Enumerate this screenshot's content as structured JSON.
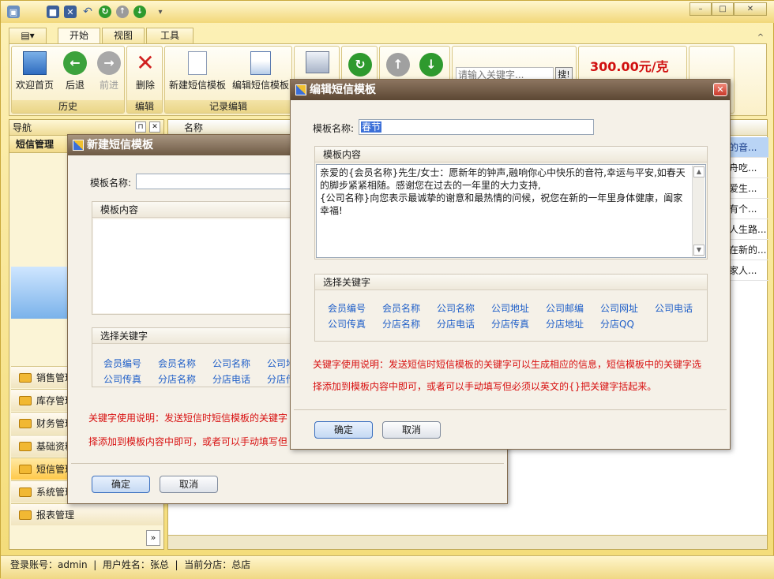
{
  "qat": {
    "icons": [
      "app-icon",
      "save-icon",
      "save-close-icon",
      "undo-icon",
      "refresh-icon",
      "up-icon",
      "down-icon",
      "customize-icon"
    ]
  },
  "tabs": [
    "开始",
    "视图",
    "工具"
  ],
  "ribbon": {
    "history": {
      "label": "历史",
      "home": "欢迎首页",
      "back": "后退",
      "forward": "前进"
    },
    "edit": {
      "label": "编辑",
      "delete": "删除"
    },
    "record": {
      "label": "记录编辑",
      "new_template": "新建短信模板",
      "edit_template": "编辑短信模板"
    },
    "search": {
      "placeholder": "请输入关键字...",
      "button": "搜!"
    },
    "price": "300.00元/克"
  },
  "nav": {
    "header": "导航",
    "title": "短信管理",
    "items": [
      "销售管理",
      "库存管理",
      "财务管理",
      "基础资料",
      "短信管理",
      "系统管理",
      "报表管理"
    ]
  },
  "grid": {
    "header": "名称",
    "cells": [
      "的音...",
      "舟吃...",
      "爱生...",
      "有个...",
      "人生路...",
      "在新的...",
      "家人..."
    ]
  },
  "status": {
    "text": "登录账号：admin  |  用户姓名：张总  |  当前分店：总店"
  },
  "new_dialog": {
    "title": "新建短信模板",
    "name_label": "模板名称:",
    "name_value": "",
    "content_label": "模板内容",
    "keywords_label": "选择关键字",
    "keywords_row1": [
      "会员编号",
      "会员名称",
      "公司名称",
      "公司地址"
    ],
    "keywords_row2": [
      "公司传真",
      "分店名称",
      "分店电话",
      "分店传真"
    ],
    "note_line1": "关键字使用说明：发送短信时短信模板的关键字",
    "note_line2": "择添加到模板内容中即可，或者可以手动填写但",
    "ok": "确定",
    "cancel": "取消"
  },
  "edit_dialog": {
    "title": "编辑短信模板",
    "name_label": "模板名称:",
    "name_value": "春节",
    "content_label": "模板内容",
    "content_line1": "亲爱的{会员名称}先生/女士：愿新年的钟声,融响你心中快乐的音符,幸运与平安,如春天的脚步紧紧相随。感谢您在过去的一年里的大力支持,",
    "content_line2": "{公司名称}向您表示最诚挚的谢意和最热情的问候，祝您在新的一年里身体健康，阖家幸福!",
    "keywords_label": "选择关键字",
    "keywords_row1": [
      "会员编号",
      "会员名称",
      "公司名称",
      "公司地址",
      "公司邮编",
      "公司网址",
      "公司电话"
    ],
    "keywords_row2": [
      "公司传真",
      "分店名称",
      "分店电话",
      "分店传真",
      "分店地址",
      "分店QQ"
    ],
    "note_line1": "关键字使用说明：发送短信时短信模板的关键字可以生成相应的信息，短信模板中的关键字选",
    "note_line2": "择添加到模板内容中即可，或者可以手动填写但必须以英文的{}把关键字括起来。",
    "ok": "确定",
    "cancel": "取消"
  }
}
